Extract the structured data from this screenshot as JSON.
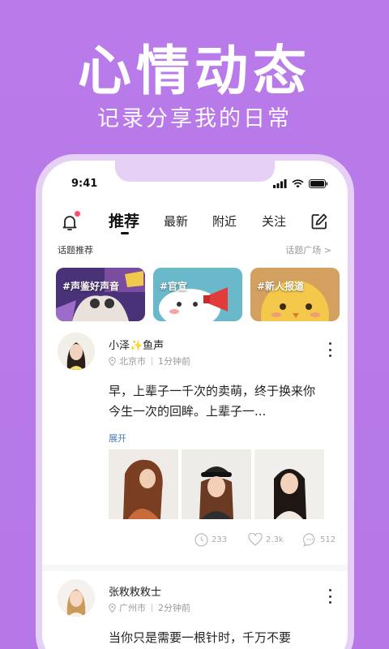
{
  "hero": {
    "title": "心情动态",
    "subtitle": "记录分享我的日常"
  },
  "status_bar": {
    "time": "9:41"
  },
  "tabs": [
    {
      "label": "推荐",
      "active": true
    },
    {
      "label": "最新",
      "active": false
    },
    {
      "label": "附近",
      "active": false
    },
    {
      "label": "关注",
      "active": false
    }
  ],
  "topics": {
    "title": "话题推荐",
    "more": "话题广场 >",
    "items": [
      {
        "label": "#声鉴好声音"
      },
      {
        "label": "#官宣"
      },
      {
        "label": "#新人报道"
      }
    ]
  },
  "posts": [
    {
      "user": "小泽✨鱼声",
      "location": "北京市",
      "time": "1分钟前",
      "text": "早，上辈子一千次的卖萌，终于换来你今生一次的回眸。上辈子一...",
      "expand": "展开",
      "stats": {
        "views": "233",
        "likes": "2.3k",
        "comments": "512"
      }
    },
    {
      "user": "张敉敉敉士",
      "location": "广州市",
      "time": "2分钟前",
      "text": "当你只是需要一根针时，千万不要"
    }
  ],
  "colors": {
    "background": "#b87be9",
    "phone_frame": "#e6d0f6",
    "accent_dot": "#ff4d6a",
    "link": "#4a78c2"
  }
}
